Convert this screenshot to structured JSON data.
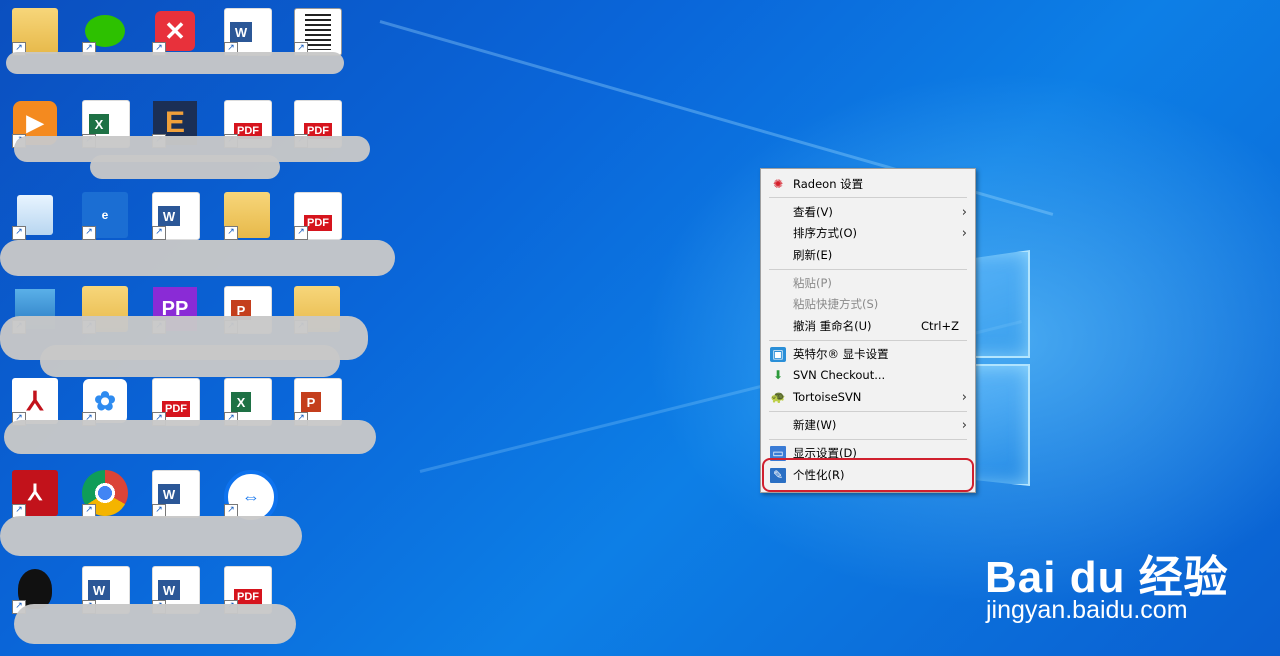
{
  "context_menu": {
    "items": [
      {
        "label": "Radeon 设置",
        "icon": "radeon-icon",
        "disabled": false
      },
      {
        "label": "查看(V)",
        "submenu": true,
        "disabled": false
      },
      {
        "label": "排序方式(O)",
        "submenu": true,
        "disabled": false
      },
      {
        "label": "刷新(E)",
        "disabled": false
      },
      {
        "label": "粘贴(P)",
        "disabled": true
      },
      {
        "label": "粘贴快捷方式(S)",
        "disabled": true
      },
      {
        "label": "撤消 重命名(U)",
        "shortcut": "Ctrl+Z",
        "disabled": false
      },
      {
        "label": "英特尔® 显卡设置",
        "icon": "intel-graphics-icon",
        "disabled": false
      },
      {
        "label": "SVN Checkout...",
        "icon": "svn-checkout-icon",
        "disabled": false
      },
      {
        "label": "TortoiseSVN",
        "icon": "tortoisesvn-icon",
        "submenu": true,
        "disabled": false
      },
      {
        "label": "新建(W)",
        "submenu": true,
        "disabled": false
      },
      {
        "label": "显示设置(D)",
        "icon": "display-settings-icon",
        "disabled": false
      },
      {
        "label": "个性化(R)",
        "icon": "personalize-icon",
        "disabled": false,
        "highlighted": true
      }
    ]
  },
  "desktop_icons": [
    {
      "type": "folder-excel",
      "text": ""
    },
    {
      "type": "wechat",
      "text": ""
    },
    {
      "type": "xmind",
      "text": ""
    },
    {
      "type": "word-doc",
      "text": "W"
    },
    {
      "type": "document",
      "text": ""
    },
    {
      "type": "video-player",
      "text": ""
    },
    {
      "type": "excel",
      "text": "X"
    },
    {
      "type": "app-e",
      "text": "E"
    },
    {
      "type": "pdf",
      "text": "PDF"
    },
    {
      "type": "pdf",
      "text": "PDF"
    },
    {
      "type": "recycle-bin",
      "text": ""
    },
    {
      "type": "edge",
      "text": "e"
    },
    {
      "type": "word-doc",
      "text": "W"
    },
    {
      "type": "folder",
      "text": ""
    },
    {
      "type": "pdf",
      "text": "PDF"
    },
    {
      "type": "winrar",
      "text": ""
    },
    {
      "type": "folder",
      "text": ""
    },
    {
      "type": "premiere",
      "text": "PP"
    },
    {
      "type": "powerpoint",
      "text": "P"
    },
    {
      "type": "folder",
      "text": ""
    },
    {
      "type": "acrobat",
      "text": ""
    },
    {
      "type": "baidu-netdisk",
      "text": ""
    },
    {
      "type": "pdf",
      "text": "PDF"
    },
    {
      "type": "excel",
      "text": "X"
    },
    {
      "type": "ppt-file",
      "text": "P"
    },
    {
      "type": "acrobat-reader",
      "text": ""
    },
    {
      "type": "chrome",
      "text": ""
    },
    {
      "type": "word",
      "text": "W"
    },
    {
      "type": "teamviewer",
      "text": "⇔"
    },
    {
      "type": "qq",
      "text": ""
    },
    {
      "type": "word",
      "text": "W"
    },
    {
      "type": "word-doc",
      "text": "W"
    },
    {
      "type": "pdf",
      "text": "PDF"
    }
  ],
  "watermark": {
    "brand": "Bai du 经验",
    "url": "jingyan.baidu.com"
  },
  "colors": {
    "highlight_ring": "#d0202e",
    "menu_bg": "#f2f2f2",
    "pdf_red": "#d6141d"
  }
}
